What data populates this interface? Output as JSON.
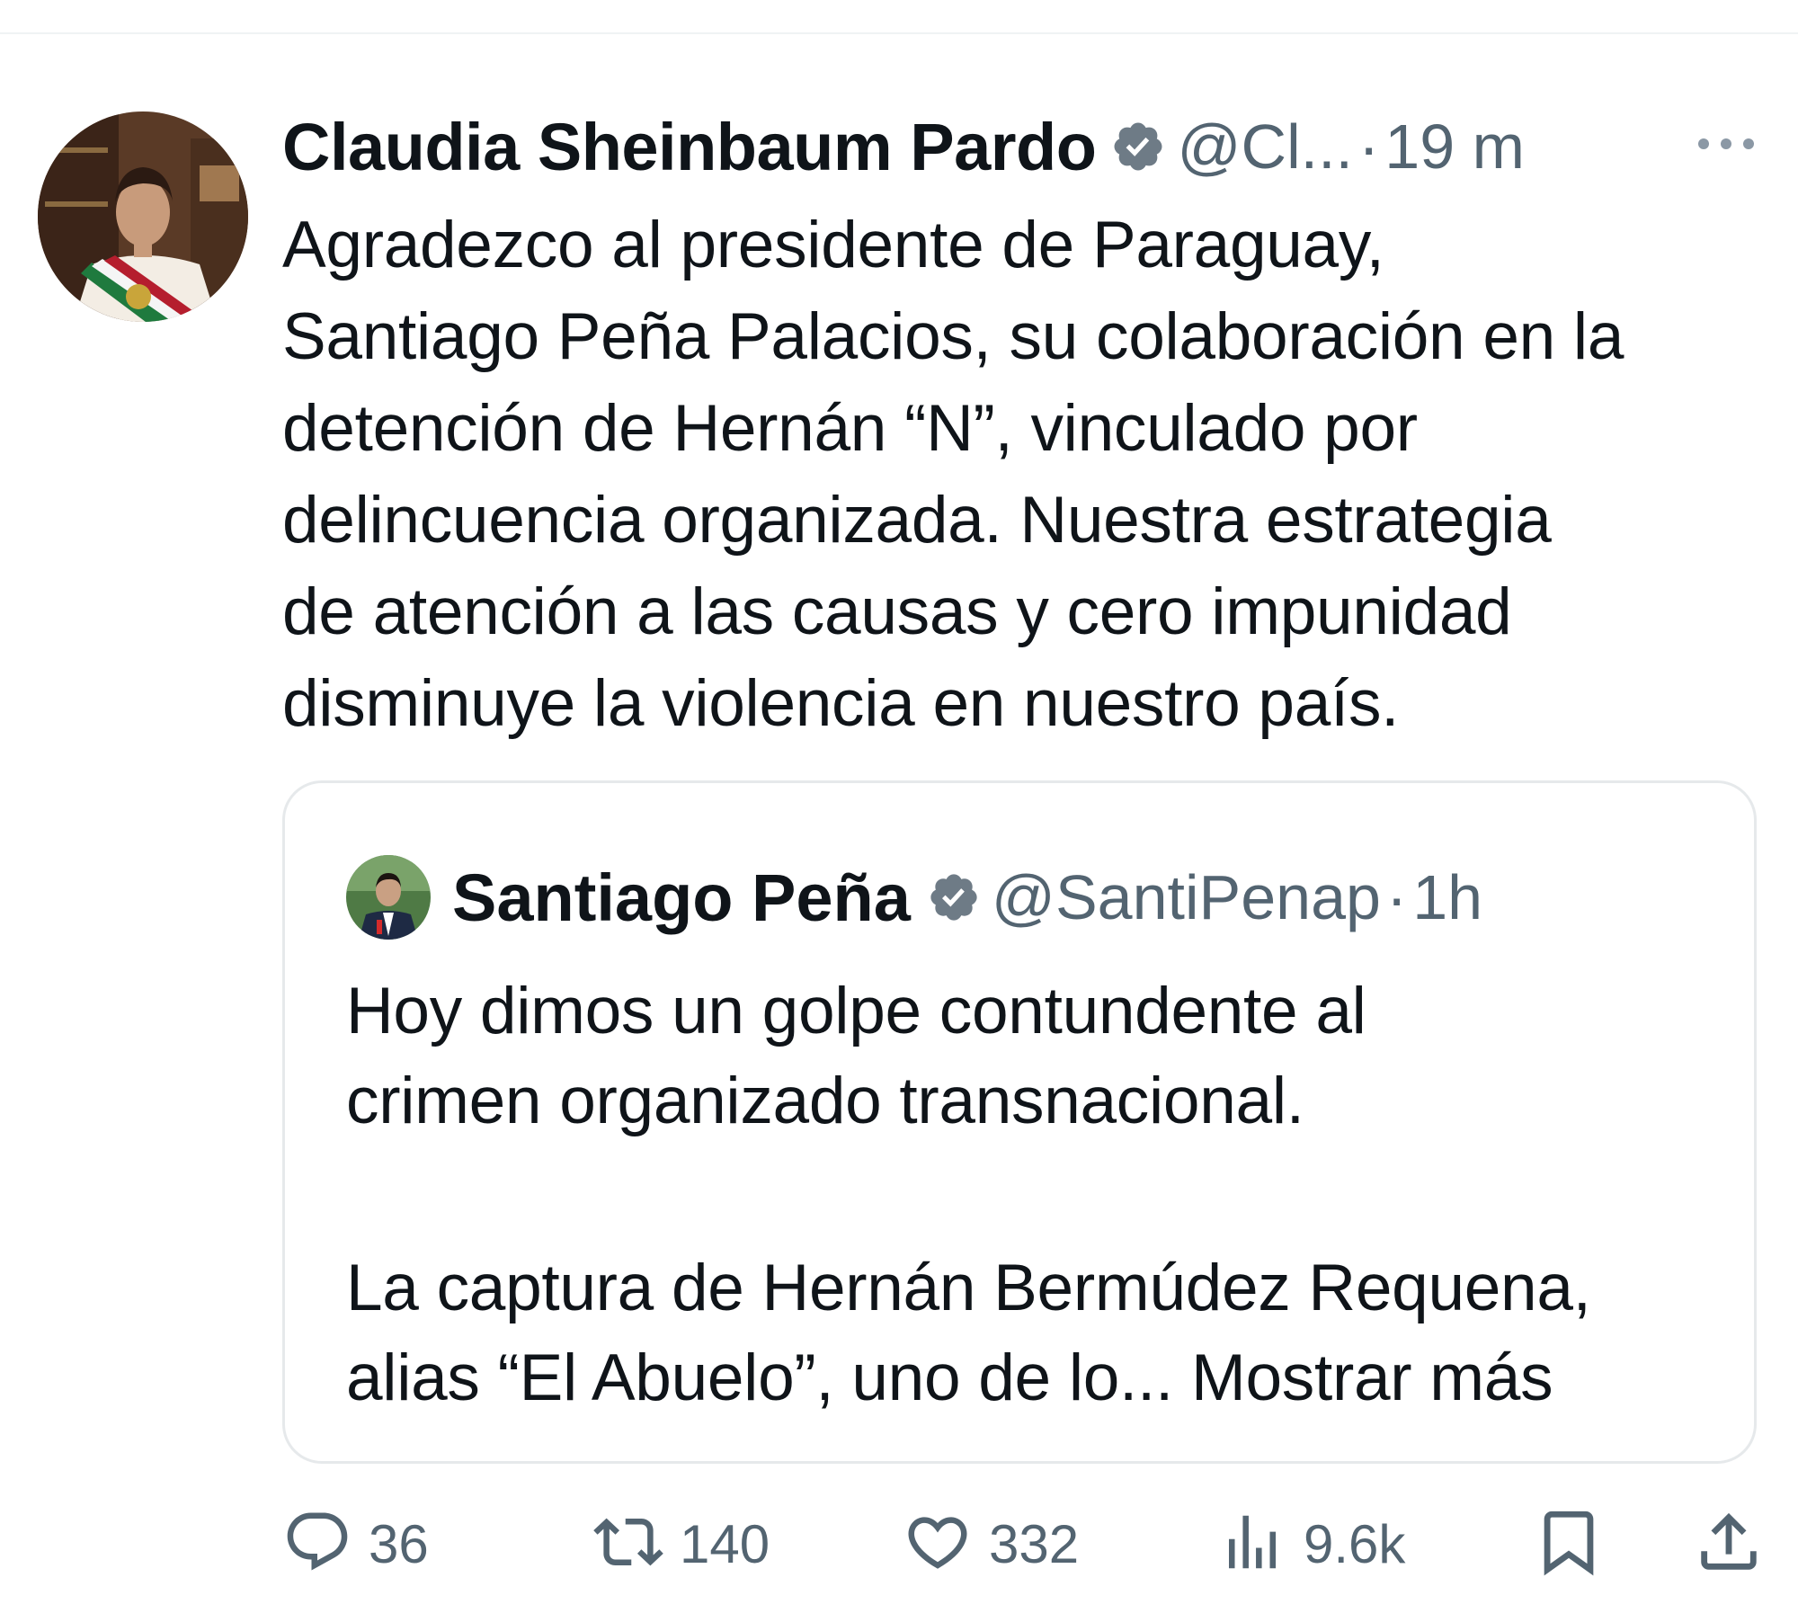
{
  "tweet": {
    "author": {
      "name": "Claudia Sheinbaum Pardo",
      "handle": "@Cl...",
      "verified": true,
      "time": "19 m"
    },
    "separator": "·",
    "text_lines": [
      "Agradezco al presidente de Paraguay,",
      "Santiago Peña Palacios, su colaboración en la",
      "detención de Hernán “N”, vinculado por",
      "delincuencia organizada. Nuestra estrategia",
      "de atención a las causas y cero impunidad",
      "disminuye la violencia en nuestro país."
    ],
    "quote": {
      "author": {
        "name": "Santiago Peña",
        "handle": "@SantiPenap",
        "verified": true,
        "time": "1h"
      },
      "paragraph1": [
        "Hoy dimos un golpe contundente al",
        "crimen organizado transnacional."
      ],
      "paragraph2_line1": "La captura de Hernán Bermúdez Requena,",
      "paragraph2_line2": "alias “El Abuelo”, uno de lo...",
      "show_more": "Mostrar más"
    },
    "actions": {
      "replies": "36",
      "reposts": "140",
      "likes": "332",
      "views": "9.6k"
    }
  },
  "icons": {
    "verified": "verified-badge-icon",
    "more": "more-options-icon",
    "reply": "reply-icon",
    "repost": "repost-icon",
    "like": "like-icon",
    "views": "views-icon",
    "bookmark": "bookmark-icon",
    "share": "share-icon"
  },
  "colors": {
    "text": "#0f1419",
    "secondary": "#536471",
    "border": "#e6e9eb",
    "verified_badge": "#6e7b86"
  }
}
